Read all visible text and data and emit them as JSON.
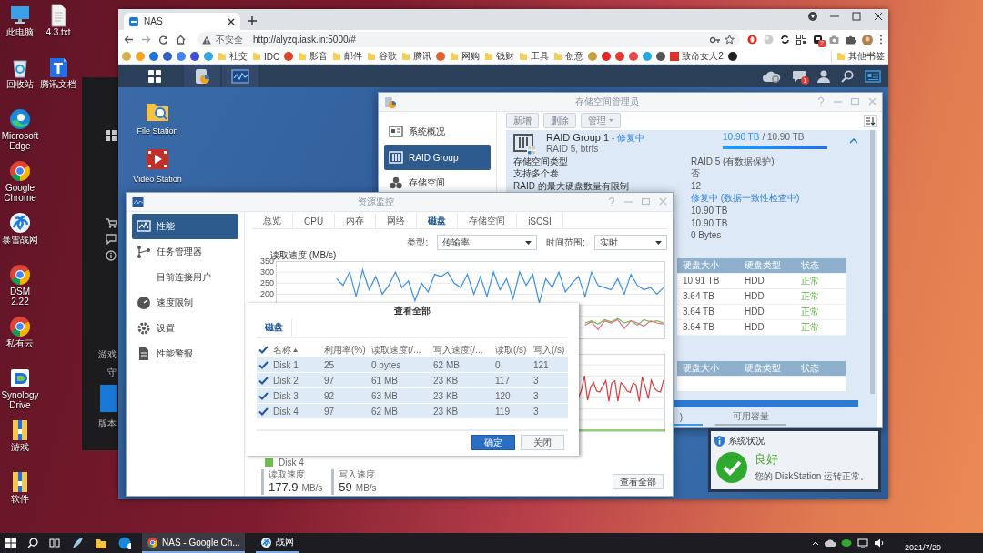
{
  "desktop": {
    "icon_columns": [
      [
        {
          "label": "此电脑",
          "kind": "computer"
        },
        {
          "label": "回收站",
          "kind": "recycle"
        },
        {
          "label": "Microsoft Edge",
          "kind": "edge"
        },
        {
          "label": "Google Chrome",
          "kind": "chrome"
        },
        {
          "label": "暴雪战网",
          "kind": "swirl"
        },
        {
          "label": "DSM 2.22",
          "kind": "chrome"
        },
        {
          "label": "私有云",
          "kind": "chrome"
        },
        {
          "label": "Synology Drive",
          "kind": "drive"
        },
        {
          "label": "游戏",
          "kind": "archive"
        },
        {
          "label": "软件",
          "kind": "archive"
        }
      ],
      [
        {
          "label": "4.3.txt",
          "kind": "file"
        },
        {
          "label": "腾讯文档",
          "kind": "docs"
        }
      ]
    ],
    "background_window": {
      "texts": [
        "游戏",
        "守",
        "版本"
      ]
    }
  },
  "browser": {
    "tab": {
      "title": "NAS",
      "selected": true
    },
    "security": "不安全",
    "url": "http://alyzq.iask.in:5000/#",
    "extension_badge": "2",
    "bookmarks": [
      {
        "kind": "favicon",
        "color": "#d8b050"
      },
      {
        "kind": "favicon",
        "color": "#f5a623"
      },
      {
        "kind": "favicon",
        "color": "#1e73d8"
      },
      {
        "kind": "favicon",
        "color": "#2f5fc6"
      },
      {
        "kind": "favicon",
        "color": "#4285f4"
      },
      {
        "kind": "favicon",
        "color": "#3b4fd9"
      },
      {
        "kind": "favicon",
        "color": "#38a5e0"
      },
      {
        "kind": "folder",
        "label": "社交"
      },
      {
        "kind": "folder",
        "label": "IDC"
      },
      {
        "kind": "favicon",
        "color": "#e0402a"
      },
      {
        "kind": "folder",
        "label": "影音"
      },
      {
        "kind": "folder",
        "label": "邮件"
      },
      {
        "kind": "folder",
        "label": "谷歌"
      },
      {
        "kind": "folder",
        "label": "腾讯"
      },
      {
        "kind": "favicon",
        "color": "#e8602a"
      },
      {
        "kind": "folder",
        "label": "网购"
      },
      {
        "kind": "folder",
        "label": "钱财"
      },
      {
        "kind": "folder",
        "label": "工具"
      },
      {
        "kind": "folder",
        "label": "创意"
      },
      {
        "kind": "favicon",
        "color": "#c8a040"
      },
      {
        "kind": "favicon",
        "color": "#e02828"
      },
      {
        "kind": "favicon",
        "color": "#e53935"
      },
      {
        "kind": "favicon",
        "color": "#e84848"
      },
      {
        "kind": "favicon",
        "color": "#29a8e0"
      },
      {
        "kind": "favicon",
        "color": "#555555"
      },
      {
        "kind": "site",
        "label": "致命女人2",
        "color": "#e0302a"
      },
      {
        "kind": "favicon",
        "color": "#222222"
      }
    ],
    "other_bookmarks": "其他书签"
  },
  "dsm": {
    "notification_badge": "1",
    "apps": [
      {
        "label": "File Station",
        "kind": "folder"
      },
      {
        "label": "Video Station",
        "kind": "video"
      }
    ]
  },
  "storage": {
    "title": "存储空间管理员",
    "nav": [
      {
        "label": "系统概况",
        "kind": "overview",
        "selected": false
      },
      {
        "label": "RAID Group",
        "kind": "raid",
        "selected": true
      },
      {
        "label": "存储空间",
        "kind": "volume",
        "selected": false
      }
    ],
    "toolbar": [
      {
        "label": "新增",
        "kind": "plain"
      },
      {
        "label": "删除",
        "kind": "plain"
      },
      {
        "label": "管理",
        "kind": "menu"
      }
    ],
    "group": {
      "name": "RAID Group 1",
      "status": "- 修复中",
      "subtitle": "RAID 5, btrfs",
      "used": "10.90 TB",
      "total": "/ 10.90 TB",
      "level": 1,
      "expanded": true,
      "properties": [
        {
          "label": "存储空间类型",
          "value": "RAID 5 (有数据保护)",
          "kind": "plain"
        },
        {
          "label": "支持多个卷",
          "value": "否",
          "kind": "plain"
        },
        {
          "label": "RAID 的最大硬盘数量有限制",
          "value": "12",
          "kind": "plain"
        },
        {
          "value": "修复中 (数据一致性检查中)",
          "kind": "status"
        },
        {
          "value": "10.90 TB",
          "kind": "plain"
        },
        {
          "value": "10.90 TB",
          "kind": "plain"
        },
        {
          "value": "0 Bytes",
          "kind": "plain"
        }
      ],
      "disk_table": {
        "columns": [
          "硬盘大小",
          "硬盘类型",
          "状态"
        ],
        "rows": [
          {
            "size": "10.91 TB",
            "type": "HDD",
            "status": "正常"
          },
          {
            "size": "3.64 TB",
            "type": "HDD",
            "status": "正常"
          },
          {
            "size": "3.64 TB",
            "type": "HDD",
            "status": "正常"
          },
          {
            "size": "3.64 TB",
            "type": "HDD",
            "status": "正常"
          }
        ]
      },
      "spare_table": {
        "columns": [
          "硬盘大小",
          "硬盘类型",
          "状态"
        ]
      },
      "tabs": [
        {
          "label": ")",
          "selected": true
        },
        {
          "label": "可用容量",
          "selected": false
        }
      ]
    }
  },
  "monitor": {
    "title": "资源监控",
    "nav": [
      {
        "label": "性能",
        "kind": "performance",
        "selected": true
      },
      {
        "label": "任务管理器",
        "kind": "tasks",
        "selected": false
      },
      {
        "label": "目前连接用户",
        "kind": "sub",
        "selected": false
      },
      {
        "label": "速度限制",
        "kind": "speed",
        "selected": false
      },
      {
        "label": "设置",
        "kind": "settings",
        "selected": false
      },
      {
        "label": "性能警报",
        "kind": "alert",
        "selected": false
      }
    ],
    "tabs": [
      {
        "label": "总览",
        "selected": false
      },
      {
        "label": "CPU",
        "selected": false
      },
      {
        "label": "内存",
        "selected": false
      },
      {
        "label": "网络",
        "selected": false
      },
      {
        "label": "磁盘",
        "selected": true
      },
      {
        "label": "存储空间",
        "selected": false
      },
      {
        "label": "iSCSI",
        "selected": false
      }
    ],
    "filters": [
      {
        "label": "类型:",
        "value": "传输率"
      },
      {
        "label": "时间范围:",
        "value": "实时"
      }
    ],
    "read_chart": {
      "chart_data": {
        "type": "line",
        "title": "读取速度 (MB/s)",
        "ylim": [
          0,
          350
        ],
        "yticks": [
          350,
          300,
          250,
          200
        ],
        "grid": true,
        "series": [
          {
            "color": "#3a8ee8",
            "values": [
              null,
              null,
              null,
              null,
              null,
              null,
              null,
              null,
              null,
              270,
              240,
              300,
              190,
              310,
              220,
              280,
              200,
              240,
              300,
              230,
              260,
              170,
              250,
              210,
              290,
              280,
              300,
              250,
              230,
              290,
              200,
              280,
              190,
              300,
              220,
              270,
              180,
              300,
              240,
              290,
              160,
              270,
              230,
              300,
              210,
              250,
              280,
              190,
              300,
              240,
              230,
              220,
              270,
              200,
              290,
              240,
              220,
              230,
              200,
              230
            ]
          },
          {
            "color": "#6cc04a",
            "values": [
              null,
              null,
              null,
              null,
              null,
              null,
              null,
              null,
              null,
              null,
              null,
              null,
              null,
              null,
              null,
              null,
              null,
              null,
              null,
              null,
              null,
              null,
              null,
              null,
              null,
              null,
              null,
              null,
              null,
              null,
              null,
              null,
              null,
              null,
              null,
              null,
              null,
              null,
              null,
              null,
              null,
              null,
              null,
              null,
              null,
              null,
              null,
              70,
              80,
              65,
              85,
              75,
              90,
              70,
              80,
              60,
              85,
              75,
              80,
              70
            ]
          },
          {
            "color": "#e86a8a",
            "values": [
              null,
              null,
              null,
              null,
              null,
              null,
              null,
              null,
              null,
              null,
              null,
              null,
              null,
              null,
              null,
              null,
              null,
              null,
              null,
              null,
              null,
              null,
              null,
              null,
              null,
              null,
              null,
              null,
              null,
              null,
              null,
              null,
              null,
              null,
              null,
              null,
              null,
              null,
              null,
              null,
              null,
              null,
              null,
              null,
              null,
              null,
              null,
              60,
              75,
              40,
              80,
              70,
              85,
              45,
              80,
              70,
              55,
              80,
              70,
              65
            ]
          }
        ]
      }
    },
    "legend": {
      "label": "Disk 4",
      "color": "#6cc04a"
    },
    "stats": [
      {
        "label": "读取速度",
        "value": "177.9",
        "unit": "MB/s"
      },
      {
        "label": "写入速度",
        "value": "59",
        "unit": "MB/s"
      }
    ],
    "view_all": "查看全部"
  },
  "dialog": {
    "title": "查看全部",
    "tabs": [
      {
        "label": "磁盘",
        "selected": true
      }
    ],
    "all_checked": true,
    "columns": [
      {
        "label": "名称",
        "sorted": true
      },
      {
        "label": "利用率(%)",
        "sorted": false
      },
      {
        "label": "读取速度(/...",
        "sorted": false
      },
      {
        "label": "写入速度(/...",
        "sorted": false
      },
      {
        "label": "读取(/s)",
        "sorted": false
      },
      {
        "label": "写入(/s)",
        "sorted": false
      }
    ],
    "rows": [
      {
        "checked": true,
        "selected": true,
        "cells": [
          "Disk 1",
          "25",
          "0 bytes",
          "62 MB",
          "0",
          "121"
        ]
      },
      {
        "checked": true,
        "selected": true,
        "cells": [
          "Disk 2",
          "97",
          "61 MB",
          "23 KB",
          "117",
          "3"
        ]
      },
      {
        "checked": true,
        "selected": true,
        "cells": [
          "Disk 3",
          "92",
          "63 MB",
          "23 KB",
          "120",
          "3"
        ]
      },
      {
        "checked": true,
        "selected": true,
        "cells": [
          "Disk 4",
          "97",
          "62 MB",
          "23 KB",
          "119",
          "3"
        ]
      }
    ],
    "buttons": [
      {
        "label": "确定",
        "kind": "primary"
      },
      {
        "label": "关闭",
        "kind": "secondary"
      }
    ]
  },
  "status_widget": {
    "title": "系统状况",
    "status": "良好",
    "message": "您的 DiskStation 运转正常。"
  },
  "taskbar": {
    "apps": [
      {
        "label": "NAS - Google Ch...",
        "kind": "chrome",
        "selected": true
      },
      {
        "label": "战网",
        "kind": "swirl",
        "selected": false
      }
    ],
    "date": "2021/7/29"
  }
}
